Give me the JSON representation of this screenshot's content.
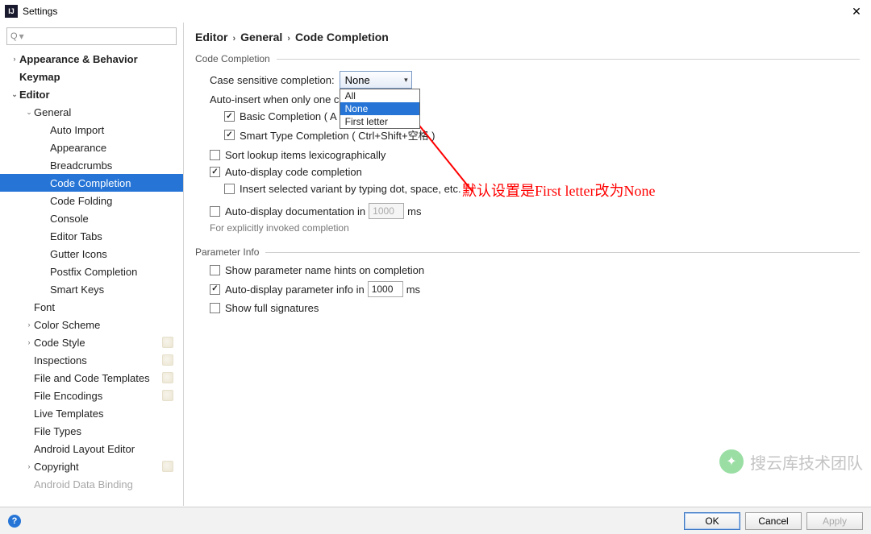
{
  "window": {
    "title": "Settings"
  },
  "search": {
    "placeholder": ""
  },
  "tree": [
    {
      "label": "Appearance & Behavior",
      "level": 0,
      "arrow": "›",
      "bold": true
    },
    {
      "label": "Keymap",
      "level": 0,
      "arrow": "",
      "bold": true
    },
    {
      "label": "Editor",
      "level": 0,
      "arrow": "⌄",
      "bold": true
    },
    {
      "label": "General",
      "level": 1,
      "arrow": "⌄",
      "bold": false
    },
    {
      "label": "Auto Import",
      "level": 2,
      "arrow": "",
      "bold": false
    },
    {
      "label": "Appearance",
      "level": 2,
      "arrow": "",
      "bold": false
    },
    {
      "label": "Breadcrumbs",
      "level": 2,
      "arrow": "",
      "bold": false
    },
    {
      "label": "Code Completion",
      "level": 2,
      "arrow": "",
      "bold": false,
      "selected": true
    },
    {
      "label": "Code Folding",
      "level": 2,
      "arrow": "",
      "bold": false
    },
    {
      "label": "Console",
      "level": 2,
      "arrow": "",
      "bold": false
    },
    {
      "label": "Editor Tabs",
      "level": 2,
      "arrow": "",
      "bold": false
    },
    {
      "label": "Gutter Icons",
      "level": 2,
      "arrow": "",
      "bold": false
    },
    {
      "label": "Postfix Completion",
      "level": 2,
      "arrow": "",
      "bold": false
    },
    {
      "label": "Smart Keys",
      "level": 2,
      "arrow": "",
      "bold": false
    },
    {
      "label": "Font",
      "level": 1,
      "arrow": "",
      "bold": false
    },
    {
      "label": "Color Scheme",
      "level": 1,
      "arrow": "›",
      "bold": false
    },
    {
      "label": "Code Style",
      "level": 1,
      "arrow": "›",
      "bold": false,
      "badge": true
    },
    {
      "label": "Inspections",
      "level": 1,
      "arrow": "",
      "bold": false,
      "badge": true
    },
    {
      "label": "File and Code Templates",
      "level": 1,
      "arrow": "",
      "bold": false,
      "badge": true
    },
    {
      "label": "File Encodings",
      "level": 1,
      "arrow": "",
      "bold": false,
      "badge": true
    },
    {
      "label": "Live Templates",
      "level": 1,
      "arrow": "",
      "bold": false
    },
    {
      "label": "File Types",
      "level": 1,
      "arrow": "",
      "bold": false
    },
    {
      "label": "Android Layout Editor",
      "level": 1,
      "arrow": "",
      "bold": false
    },
    {
      "label": "Copyright",
      "level": 1,
      "arrow": "›",
      "bold": false,
      "badge": true
    },
    {
      "label": "Android Data Binding",
      "level": 1,
      "arrow": "",
      "bold": false,
      "cut": true
    }
  ],
  "breadcrumb": {
    "a": "Editor",
    "b": "General",
    "c": "Code Completion"
  },
  "sections": {
    "codeCompletion": {
      "title": "Code Completion",
      "caseSensitiveLabel": "Case sensitive completion:",
      "caseSensitiveValue": "None",
      "options": {
        "all": "All",
        "none": "None",
        "first": "First letter"
      },
      "autoInsertLabel": "Auto-insert when only one c",
      "basic": "Basic Completion ( A",
      "smart": "Smart Type Completion ( Ctrl+Shift+空格 )",
      "sortLookup": "Sort lookup items lexicographically",
      "autoDisplayCode": "Auto-display code completion",
      "insertSelected": "Insert selected variant by typing dot, space, etc.",
      "autoDisplayDoc": "Auto-display documentation in",
      "docMs": "1000",
      "msUnit": "ms",
      "docHint": "For explicitly invoked completion"
    },
    "paramInfo": {
      "title": "Parameter Info",
      "showHints": "Show parameter name hints on completion",
      "autoDisplayParam": "Auto-display parameter info in",
      "paramMs": "1000",
      "msUnit": "ms",
      "showFull": "Show full signatures"
    }
  },
  "buttons": {
    "ok": "OK",
    "cancel": "Cancel",
    "apply": "Apply"
  },
  "annotation": "默认设置是First letter改为None",
  "watermark": {
    "text": "搜云库技术团队"
  }
}
